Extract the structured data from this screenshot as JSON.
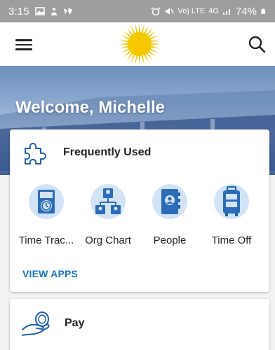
{
  "status_bar": {
    "time": "3:15",
    "network": "4G",
    "lte": "Vo) LTE",
    "battery": "74%"
  },
  "header": {
    "menu_icon": "hamburger-menu-icon",
    "logo_icon": "sun-logo-icon",
    "search_icon": "search-icon"
  },
  "hero": {
    "welcome": "Welcome, Michelle"
  },
  "frequently_used": {
    "title": "Frequently Used",
    "icon": "puzzle-icon",
    "apps": [
      {
        "label": "Time Trac...",
        "icon": "time-tracking-icon"
      },
      {
        "label": "Org Chart",
        "icon": "org-chart-icon"
      },
      {
        "label": "People",
        "icon": "people-icon"
      },
      {
        "label": "Time Off",
        "icon": "time-off-icon"
      }
    ],
    "view_apps": "VIEW APPS"
  },
  "pay": {
    "title": "Pay",
    "icon": "pay-icon"
  },
  "colors": {
    "accent": "#1a73c9",
    "icon_blue": "#1f5fae",
    "icon_bg": "#d3e3f7",
    "sun": "#f5c800",
    "status_bar": "#9e9e9e"
  }
}
